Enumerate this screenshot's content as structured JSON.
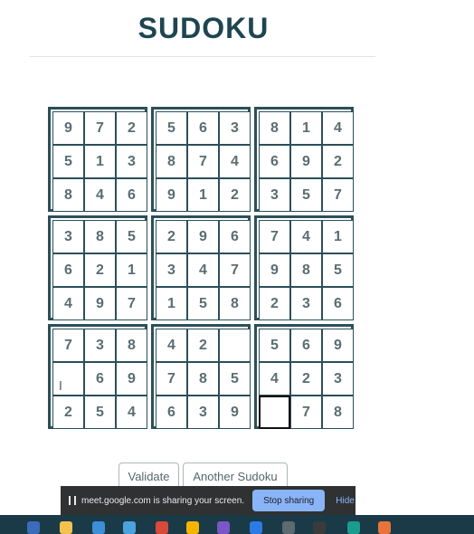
{
  "page": {
    "title": "SUDOKU"
  },
  "grid": [
    [
      "9",
      "7",
      "2",
      "5",
      "6",
      "3",
      "8",
      "1",
      "4"
    ],
    [
      "5",
      "1",
      "3",
      "8",
      "7",
      "4",
      "6",
      "9",
      "2"
    ],
    [
      "8",
      "4",
      "6",
      "9",
      "1",
      "2",
      "3",
      "5",
      "7"
    ],
    [
      "3",
      "8",
      "5",
      "2",
      "9",
      "6",
      "7",
      "4",
      "1"
    ],
    [
      "6",
      "2",
      "1",
      "3",
      "4",
      "7",
      "9",
      "8",
      "5"
    ],
    [
      "4",
      "9",
      "7",
      "1",
      "5",
      "8",
      "2",
      "3",
      "6"
    ],
    [
      "7",
      "3",
      "8",
      "4",
      "2",
      "",
      "5",
      "6",
      "9"
    ],
    [
      "",
      "6",
      "9",
      "7",
      "8",
      "5",
      "4",
      "2",
      "3"
    ],
    [
      "2",
      "5",
      "4",
      "6",
      "3",
      "9",
      "",
      "7",
      "8"
    ]
  ],
  "selected_cell": {
    "row": 8,
    "col": 6
  },
  "actions": {
    "validate_label": "Validate",
    "another_label": "Another Sudoku"
  },
  "screen_share": {
    "message": "meet.google.com is sharing your screen.",
    "stop_label": "Stop sharing",
    "hide_label": "Hide"
  },
  "colors": {
    "title": "#1d4552",
    "grid_border": "#2c4f5a",
    "digit": "#5a6d73"
  }
}
